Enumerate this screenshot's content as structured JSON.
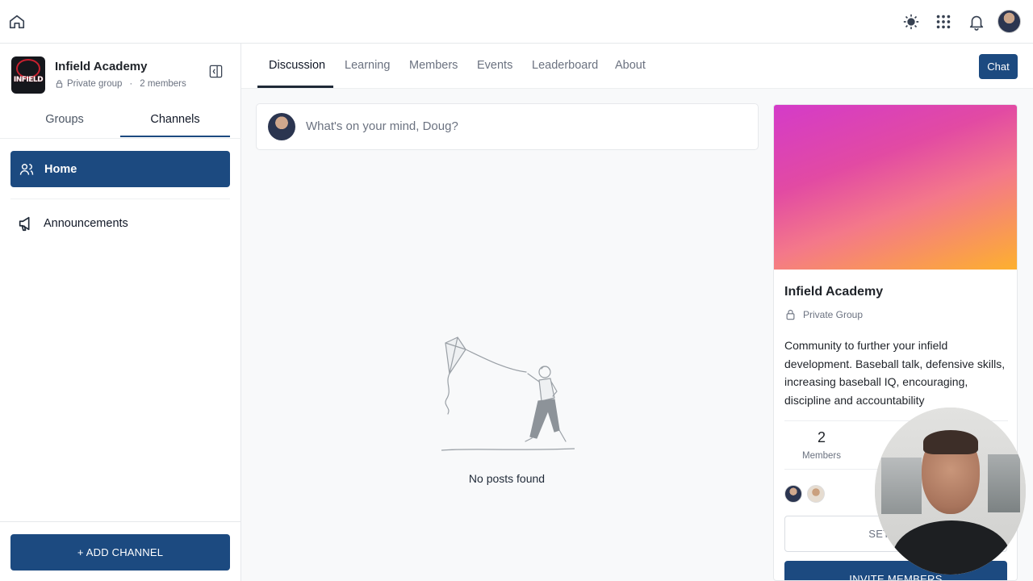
{
  "topbar": {
    "icons": [
      "home-icon",
      "sun-icon",
      "apps-grid-icon",
      "bell-icon"
    ]
  },
  "sidebar": {
    "logo_text": "INFIELD",
    "group_name": "Infield Academy",
    "privacy": "Private group",
    "separator": "·",
    "member_count": "2 members",
    "tabs": [
      {
        "label": "Groups",
        "active": false
      },
      {
        "label": "Channels",
        "active": true
      }
    ],
    "channels": [
      {
        "label": "Home",
        "icon": "users-icon",
        "active": true
      },
      {
        "label": "Announcements",
        "icon": "megaphone-icon",
        "active": false
      }
    ],
    "add_channel_label": "+ ADD CHANNEL"
  },
  "main": {
    "tabs": [
      {
        "label": "Discussion",
        "active": true
      },
      {
        "label": "Learning",
        "active": false
      },
      {
        "label": "Members",
        "active": false
      },
      {
        "label": "Events",
        "active": false
      },
      {
        "label": "Leaderboard",
        "active": false
      },
      {
        "label": "About",
        "active": false
      }
    ],
    "chat_label": "Chat",
    "composer_placeholder": "What's on your mind, Doug?",
    "empty_state": "No posts found"
  },
  "group_card": {
    "name": "Infield Academy",
    "privacy": "Private Group",
    "description": "Community to further your infield development.  Baseball talk, defensive skills, increasing baseball IQ, encouraging, discipline and accountability",
    "stats": [
      {
        "value": "2",
        "label": "Members"
      }
    ],
    "settings_label": "SETTINGS",
    "invite_label": "INVITE MEMBERS"
  },
  "colors": {
    "primary": "#1c4a80",
    "cover_start": "#d43bc9",
    "cover_end": "#fdb02e"
  }
}
